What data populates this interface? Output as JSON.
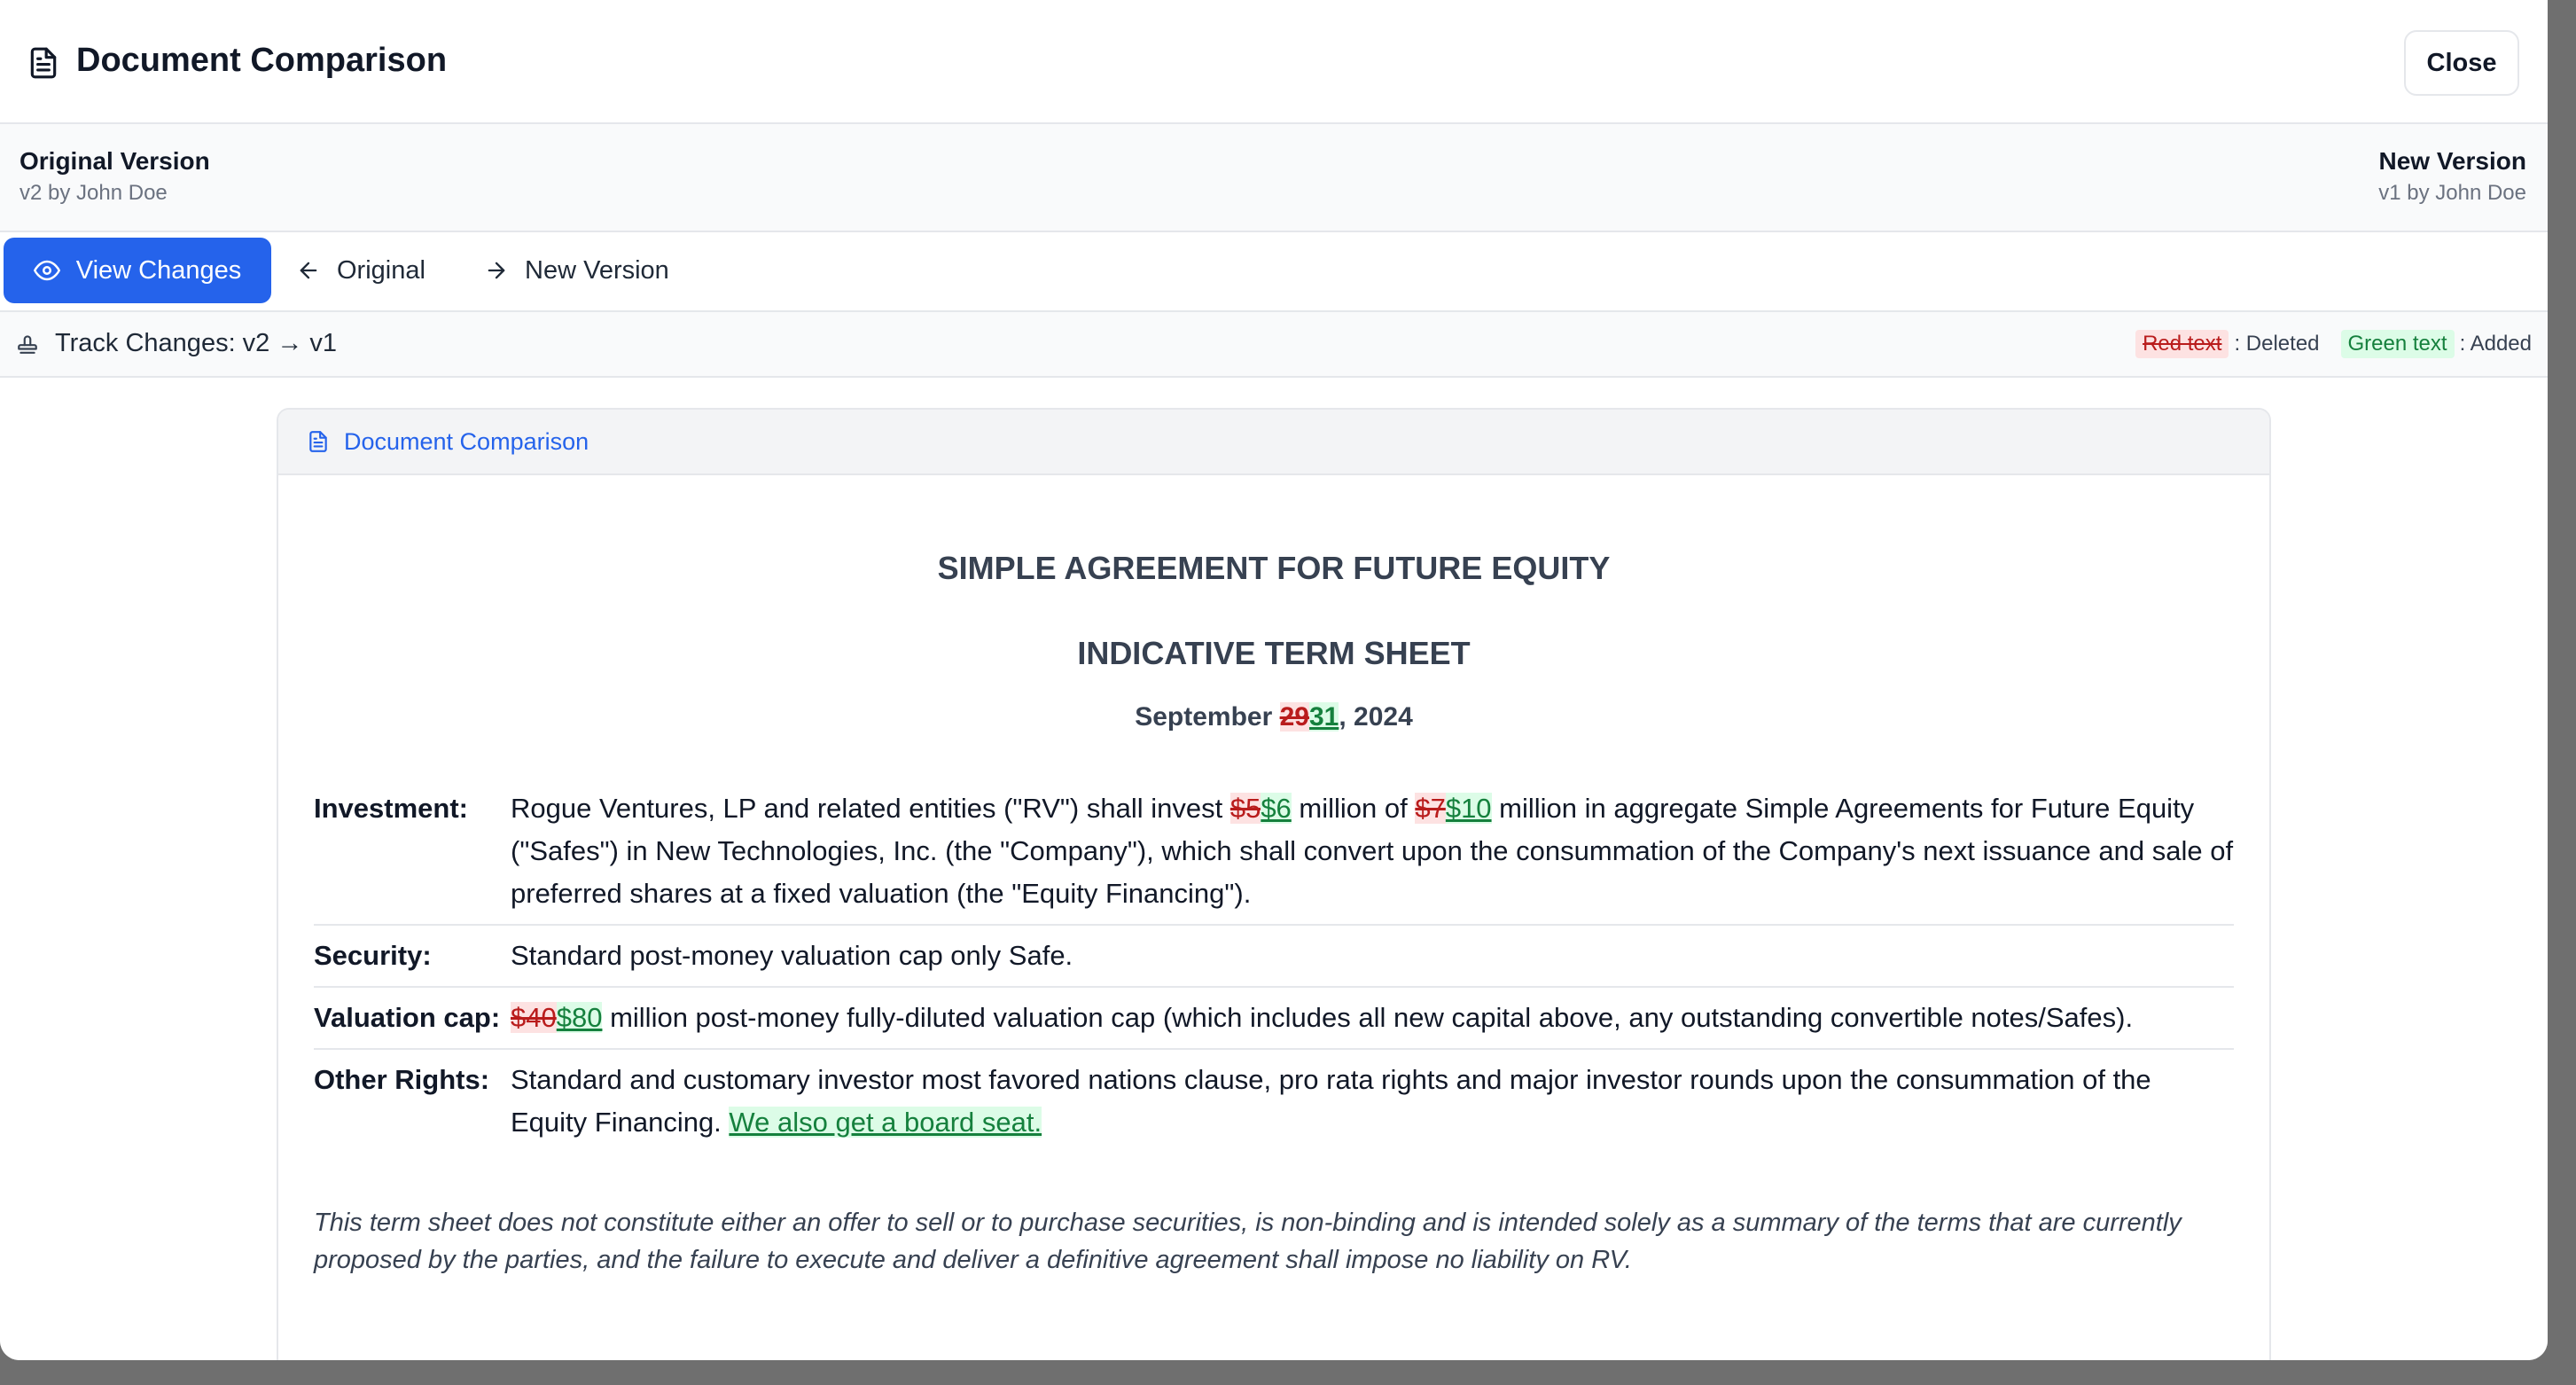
{
  "header": {
    "title": "Document Comparison",
    "close_label": "Close"
  },
  "versions": {
    "original": {
      "label": "Original Version",
      "sub": "v2 by John Doe"
    },
    "new": {
      "label": "New Version",
      "sub": "v1 by John Doe"
    }
  },
  "tabs": [
    {
      "label": "View Changes",
      "active": true
    },
    {
      "label": "Original",
      "active": false
    },
    {
      "label": "New Version",
      "active": false
    }
  ],
  "track": {
    "label": "Track Changes: v2 → v1",
    "legend_deleted_sample": "Red text",
    "legend_deleted_label": ": Deleted",
    "legend_added_sample": "Green text",
    "legend_added_label": ": Added"
  },
  "card": {
    "title": "Document Comparison"
  },
  "document": {
    "title1": "SIMPLE AGREEMENT FOR FUTURE EQUITY",
    "title2": "INDICATIVE TERM SHEET",
    "date": {
      "prefix": "September ",
      "deleted": "29",
      "added": "31",
      "suffix": ", 2024"
    },
    "terms": {
      "investment": {
        "key": "Investment:",
        "t1": "Rogue Ventures, LP and related entities (\"RV\") shall invest ",
        "d1": "$5",
        "a1": "$6",
        "t2": " million of ",
        "d2": "$7",
        "a2": "$10",
        "t3": " million in aggregate Simple Agreements for Future Equity (\"Safes\") in New Technologies, Inc. (the \"Company\"), which shall convert upon the consummation of the Company's next issuance and sale of preferred shares at a fixed valuation (the \"Equity Financing\")."
      },
      "security": {
        "key": "Security:",
        "text": "Standard post-money valuation cap only Safe."
      },
      "valuation": {
        "key": "Valuation cap:",
        "d1": "$40",
        "a1": "$80",
        "text": " million post-money fully-diluted valuation cap (which includes all new capital above, any outstanding convertible notes/Safes)."
      },
      "other": {
        "key": "Other Rights:",
        "text": "Standard and customary investor most favored nations clause, pro rata rights and major investor rounds upon the consummation of the Equity Financing. ",
        "added": "We also get a board seat."
      }
    },
    "disclaimer": "This term sheet does not constitute either an offer to sell or to purchase securities, is non-binding and is intended solely as a summary of the terms that are currently proposed by the parties, and the failure to execute and deliver a definitive agreement shall impose no liability on RV."
  },
  "colors": {
    "accent": "#2563eb",
    "deleted": "#b91c1c",
    "added": "#15803d",
    "overlay": "#6f6f6f"
  },
  "icons": [
    "document-icon",
    "eye-icon",
    "arrow-left-icon",
    "arrow-right-icon",
    "stamp-icon"
  ]
}
